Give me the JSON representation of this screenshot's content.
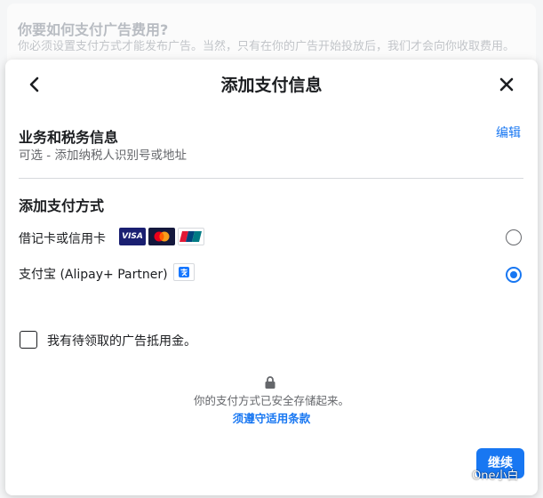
{
  "background": {
    "title": "你要如何支付广告费用?",
    "description": "你必须设置支付方式才能发布广告。当然，只有在你的广告开始投放后，我们才会向你收取费用。"
  },
  "modal": {
    "title": "添加支付信息",
    "business": {
      "title": "业务和税务信息",
      "subtitle": "可选 - 添加纳税人识别号或地址",
      "edit_label": "编辑"
    },
    "payment": {
      "title": "添加支付方式",
      "methods": [
        {
          "label": "借记卡或信用卡",
          "selected": false,
          "logos": [
            "visa-logo",
            "mastercard-logo",
            "unionpay-logo"
          ],
          "visa_text": "VISA"
        },
        {
          "label": "支付宝 (Alipay+ Partner)",
          "selected": true,
          "logos": [
            "alipay-logo"
          ]
        }
      ]
    },
    "credit_checkbox": {
      "label": "我有待领取的广告抵用金。",
      "checked": false
    },
    "secure_text": "你的支付方式已安全存储起来。",
    "terms_link": "须遵守适用条款",
    "continue_label": "继续"
  },
  "watermark": {
    "text": "One小白"
  },
  "colors": {
    "accent": "#1877f2",
    "text": "#1c1e21",
    "muted": "#65676b"
  }
}
